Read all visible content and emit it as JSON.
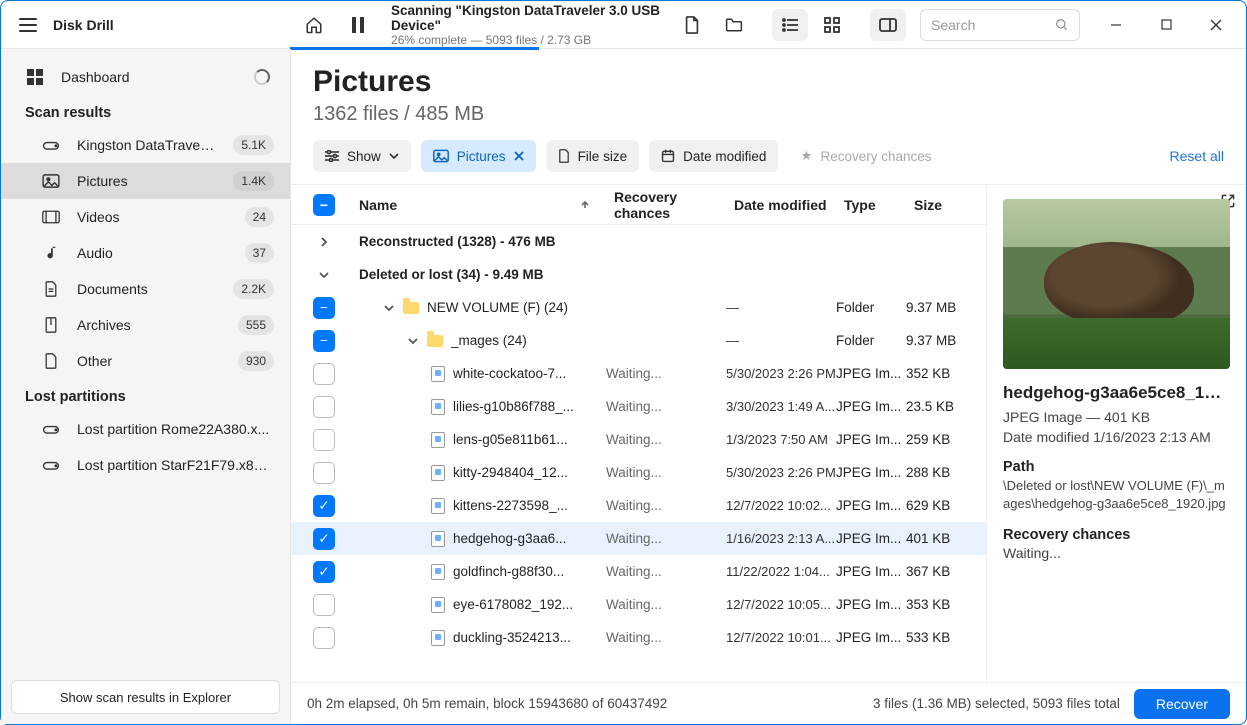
{
  "app_title": "Disk Drill",
  "scan_status": {
    "line1": "Scanning \"Kingston DataTraveler 3.0 USB Device\"",
    "line2": "26% complete — 5093 files / 2.73 GB",
    "progress_pct": 26
  },
  "search_placeholder": "Search",
  "sidebar": {
    "dashboard": "Dashboard",
    "scan_results": "Scan results",
    "items": [
      {
        "icon": "drive",
        "label": "Kingston DataTraveler 3....",
        "badge": "5.1K"
      },
      {
        "icon": "picture",
        "label": "Pictures",
        "badge": "1.4K",
        "active": true
      },
      {
        "icon": "video",
        "label": "Videos",
        "badge": "24"
      },
      {
        "icon": "audio",
        "label": "Audio",
        "badge": "37"
      },
      {
        "icon": "doc",
        "label": "Documents",
        "badge": "2.2K"
      },
      {
        "icon": "archive",
        "label": "Archives",
        "badge": "555"
      },
      {
        "icon": "other",
        "label": "Other",
        "badge": "930"
      }
    ],
    "lost_partitions": "Lost partitions",
    "lost": [
      {
        "label": "Lost partition Rome22A380.x..."
      },
      {
        "label": "Lost partition StarF21F79.x86_..."
      }
    ],
    "explorer_btn": "Show scan results in Explorer"
  },
  "heading": {
    "title": "Pictures",
    "subtitle": "1362 files / 485 MB"
  },
  "filters": {
    "show": "Show",
    "pictures": "Pictures",
    "file_size": "File size",
    "date_modified": "Date modified",
    "recovery_chances": "Recovery chances",
    "reset": "Reset all"
  },
  "columns": {
    "name": "Name",
    "rc": "Recovery chances",
    "date": "Date modified",
    "type": "Type",
    "size": "Size"
  },
  "groups": [
    {
      "kind": "group",
      "expanded": false,
      "label": "Reconstructed (1328) - 476 MB"
    },
    {
      "kind": "group",
      "expanded": true,
      "label": "Deleted or lost (34) - 9.49 MB"
    },
    {
      "kind": "folder",
      "depth": 1,
      "check": "minus",
      "expanded": true,
      "name": "NEW VOLUME (F) (24)",
      "date": "—",
      "type": "Folder",
      "size": "9.37 MB"
    },
    {
      "kind": "folder",
      "depth": 2,
      "check": "minus",
      "expanded": true,
      "name": "_mages (24)",
      "date": "—",
      "type": "Folder",
      "size": "9.37 MB"
    },
    {
      "kind": "file",
      "depth": 3,
      "check": "off",
      "name": "white-cockatoo-7...",
      "rc": "Waiting...",
      "date": "5/30/2023 2:26 PM",
      "type": "JPEG Im...",
      "size": "352 KB"
    },
    {
      "kind": "file",
      "depth": 3,
      "check": "off",
      "name": "lilies-g10b86f788_...",
      "rc": "Waiting...",
      "date": "3/30/2023 1:49 A...",
      "type": "JPEG Im...",
      "size": "23.5 KB"
    },
    {
      "kind": "file",
      "depth": 3,
      "check": "off",
      "name": "lens-g05e811b61...",
      "rc": "Waiting...",
      "date": "1/3/2023 7:50 AM",
      "type": "JPEG Im...",
      "size": "259 KB"
    },
    {
      "kind": "file",
      "depth": 3,
      "check": "off",
      "name": "kitty-2948404_12...",
      "rc": "Waiting...",
      "date": "5/30/2023 2:26 PM",
      "type": "JPEG Im...",
      "size": "288 KB"
    },
    {
      "kind": "file",
      "depth": 3,
      "check": "on",
      "name": "kittens-2273598_...",
      "rc": "Waiting...",
      "date": "12/7/2022 10:02...",
      "type": "JPEG Im...",
      "size": "629 KB"
    },
    {
      "kind": "file",
      "depth": 3,
      "check": "on",
      "sel": true,
      "name": "hedgehog-g3aa6...",
      "rc": "Waiting...",
      "date": "1/16/2023 2:13 A...",
      "type": "JPEG Im...",
      "size": "401 KB"
    },
    {
      "kind": "file",
      "depth": 3,
      "check": "on",
      "name": "goldfinch-g88f30...",
      "rc": "Waiting...",
      "date": "11/22/2022 1:04...",
      "type": "JPEG Im...",
      "size": "367 KB"
    },
    {
      "kind": "file",
      "depth": 3,
      "check": "off",
      "name": "eye-6178082_192...",
      "rc": "Waiting...",
      "date": "12/7/2022 10:05...",
      "type": "JPEG Im...",
      "size": "353 KB"
    },
    {
      "kind": "file",
      "depth": 3,
      "check": "off",
      "name": "duckling-3524213...",
      "rc": "Waiting...",
      "date": "12/7/2022 10:01...",
      "type": "JPEG Im...",
      "size": "533 KB"
    }
  ],
  "preview": {
    "filename": "hedgehog-g3aa6e5ce8_192...",
    "meta1": "JPEG Image — 401 KB",
    "meta2": "Date modified 1/16/2023 2:13 AM",
    "path_label": "Path",
    "path": "\\Deleted or lost\\NEW VOLUME (F)\\_mages\\hedgehog-g3aa6e5ce8_1920.jpg",
    "rc_label": "Recovery chances",
    "rc_value": "Waiting..."
  },
  "statusbar": {
    "left": "0h 2m elapsed, 0h 5m remain, block 15943680 of 60437492",
    "right": "3 files (1.36 MB) selected, 5093 files total",
    "recover": "Recover"
  }
}
